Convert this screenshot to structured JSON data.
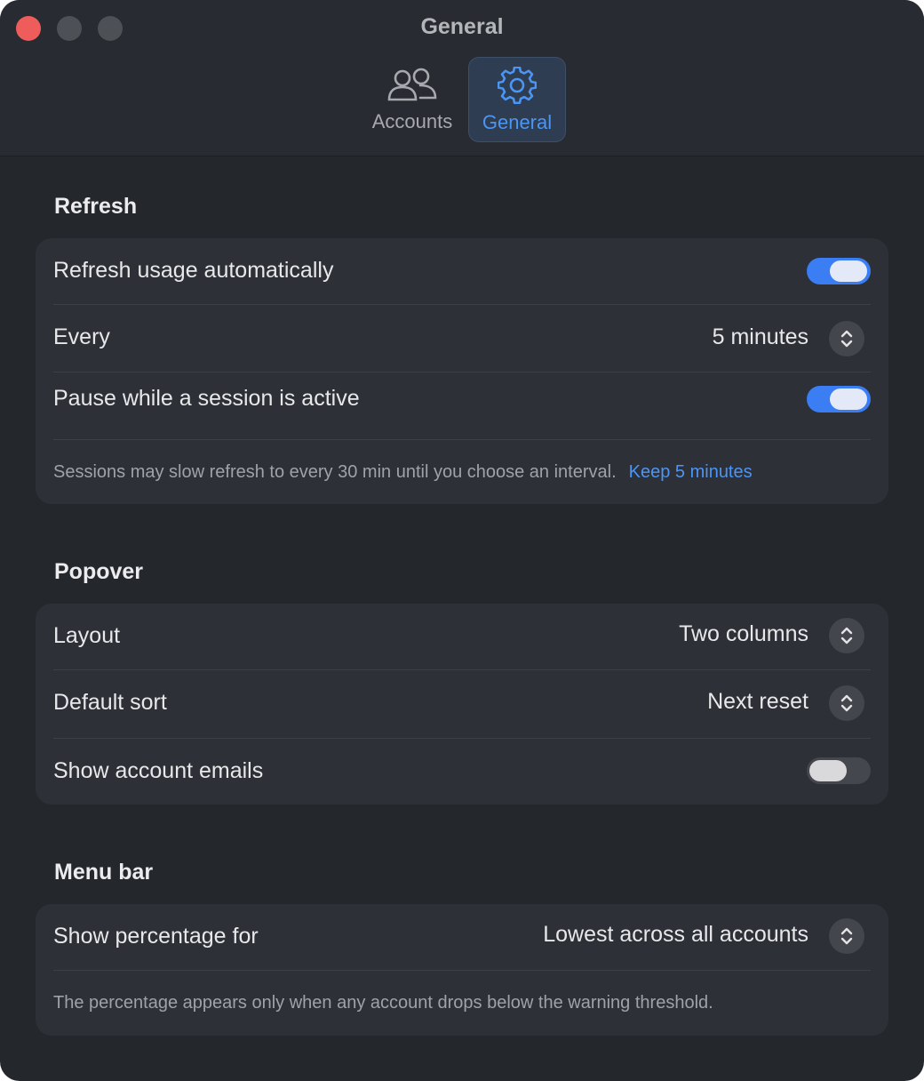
{
  "window": {
    "title": "General"
  },
  "tabs": [
    {
      "label": "Accounts",
      "icon": "people-icon",
      "selected": false
    },
    {
      "label": "General",
      "icon": "gear-icon",
      "selected": true
    }
  ],
  "refresh": {
    "title": "Refresh",
    "auto_label": "Refresh usage automatically",
    "auto_on": true,
    "every_label": "Every",
    "every_value": "5 minutes",
    "pause_label": "Pause while a session is active",
    "pause_on": true,
    "note": "Sessions may slow refresh to every 30 min until you choose an interval.",
    "note_link": "Keep 5 minutes"
  },
  "popover": {
    "title": "Popover",
    "layout_label": "Layout",
    "layout_value": "Two columns",
    "sort_label": "Default sort",
    "sort_value": "Next reset",
    "emails_label": "Show account emails",
    "emails_on": false
  },
  "menubar": {
    "title": "Menu bar",
    "percentage_label": "Show percentage for",
    "percentage_value": "Lowest across all accounts",
    "note": "The percentage appears only when any account drops below the warning threshold."
  },
  "colors": {
    "accent": "#3b7df2",
    "link": "#4c95f5",
    "close": "#ee5d5c",
    "background": "#24272c",
    "card": "#2d3036"
  }
}
